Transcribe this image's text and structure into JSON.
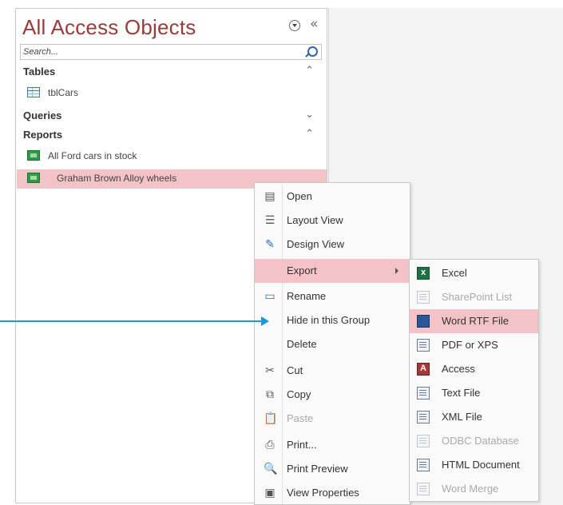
{
  "nav_pane": {
    "title": "All Access Objects",
    "search_placeholder": "Search...",
    "groups": [
      {
        "label": "Tables",
        "items": [
          "tblCars"
        ]
      },
      {
        "label": "Queries",
        "items": []
      },
      {
        "label": "Reports",
        "items": [
          "All Ford cars in stock",
          "Graham Brown Alloy wheels"
        ]
      }
    ]
  },
  "context_menu": {
    "items": [
      {
        "label": "Open",
        "icon": "open-icon"
      },
      {
        "label": "Layout View",
        "icon": "layout-view-icon"
      },
      {
        "label": "Design View",
        "icon": "design-view-icon"
      },
      {
        "label": "Export",
        "icon": "",
        "submenu": true
      },
      {
        "label": "Rename",
        "icon": "rename-icon"
      },
      {
        "label": "Hide in this Group",
        "icon": ""
      },
      {
        "label": "Delete",
        "icon": ""
      },
      {
        "label": "Cut",
        "icon": "cut-icon"
      },
      {
        "label": "Copy",
        "icon": "copy-icon"
      },
      {
        "label": "Paste",
        "icon": "paste-icon",
        "disabled": true
      },
      {
        "label": "Print...",
        "icon": "print-icon"
      },
      {
        "label": "Print Preview",
        "icon": "print-preview-icon"
      },
      {
        "label": "View Properties",
        "icon": "properties-icon"
      }
    ]
  },
  "export_submenu": {
    "items": [
      {
        "label": "Excel",
        "icon": "excel-icon"
      },
      {
        "label": "SharePoint List",
        "icon": "sharepoint-icon",
        "disabled": true
      },
      {
        "label": "Word RTF File",
        "icon": "word-icon"
      },
      {
        "label": "PDF or XPS",
        "icon": "pdf-icon"
      },
      {
        "label": "Access",
        "icon": "access-icon"
      },
      {
        "label": "Text File",
        "icon": "text-file-icon"
      },
      {
        "label": "XML File",
        "icon": "xml-file-icon"
      },
      {
        "label": "ODBC Database",
        "icon": "odbc-icon",
        "disabled": true
      },
      {
        "label": "HTML Document",
        "icon": "html-document-icon"
      },
      {
        "label": "Word Merge",
        "icon": "word-merge-icon",
        "disabled": true
      }
    ]
  },
  "colors": {
    "title": "#9c3a3a",
    "highlight": "#f4c3c8",
    "callout_arrow": "#1a9ad6"
  }
}
